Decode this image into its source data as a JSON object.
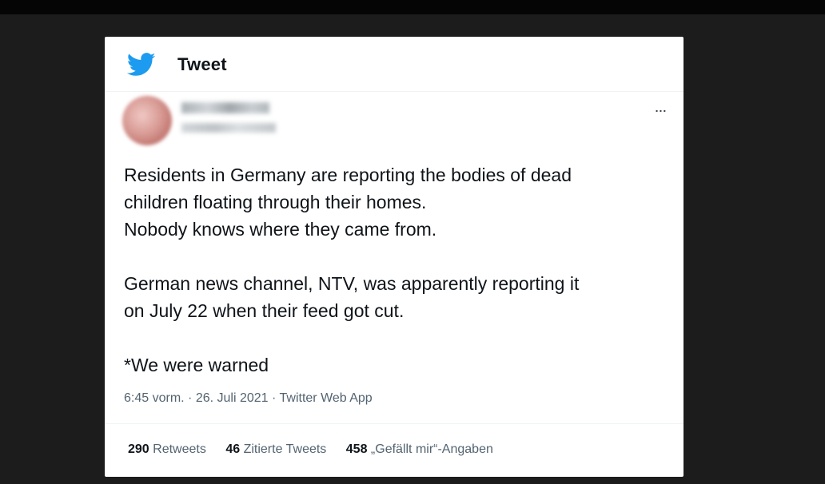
{
  "header": {
    "title": "Tweet",
    "icon": "twitter-bird-icon",
    "brand_color": "#1d9bf0"
  },
  "tweet": {
    "more_label": "...",
    "lines": [
      "Residents in Germany are reporting the bodies of dead",
      "children floating through their homes.",
      "Nobody knows where they came from.",
      "German news channel, NTV, was apparently reporting it",
      "on July 22 when their feed got cut.",
      "*We were warned"
    ],
    "meta": {
      "time": "6:45 vorm.",
      "date": "26. Juli 2021",
      "source": "Twitter Web App",
      "separator": "·"
    }
  },
  "stats": {
    "retweets_count": "290",
    "retweets_label": "Retweets",
    "quotes_count": "46",
    "quotes_label": "Zitierte Tweets",
    "likes_count": "458",
    "likes_label": "„Gefällt mir“-Angaben"
  }
}
